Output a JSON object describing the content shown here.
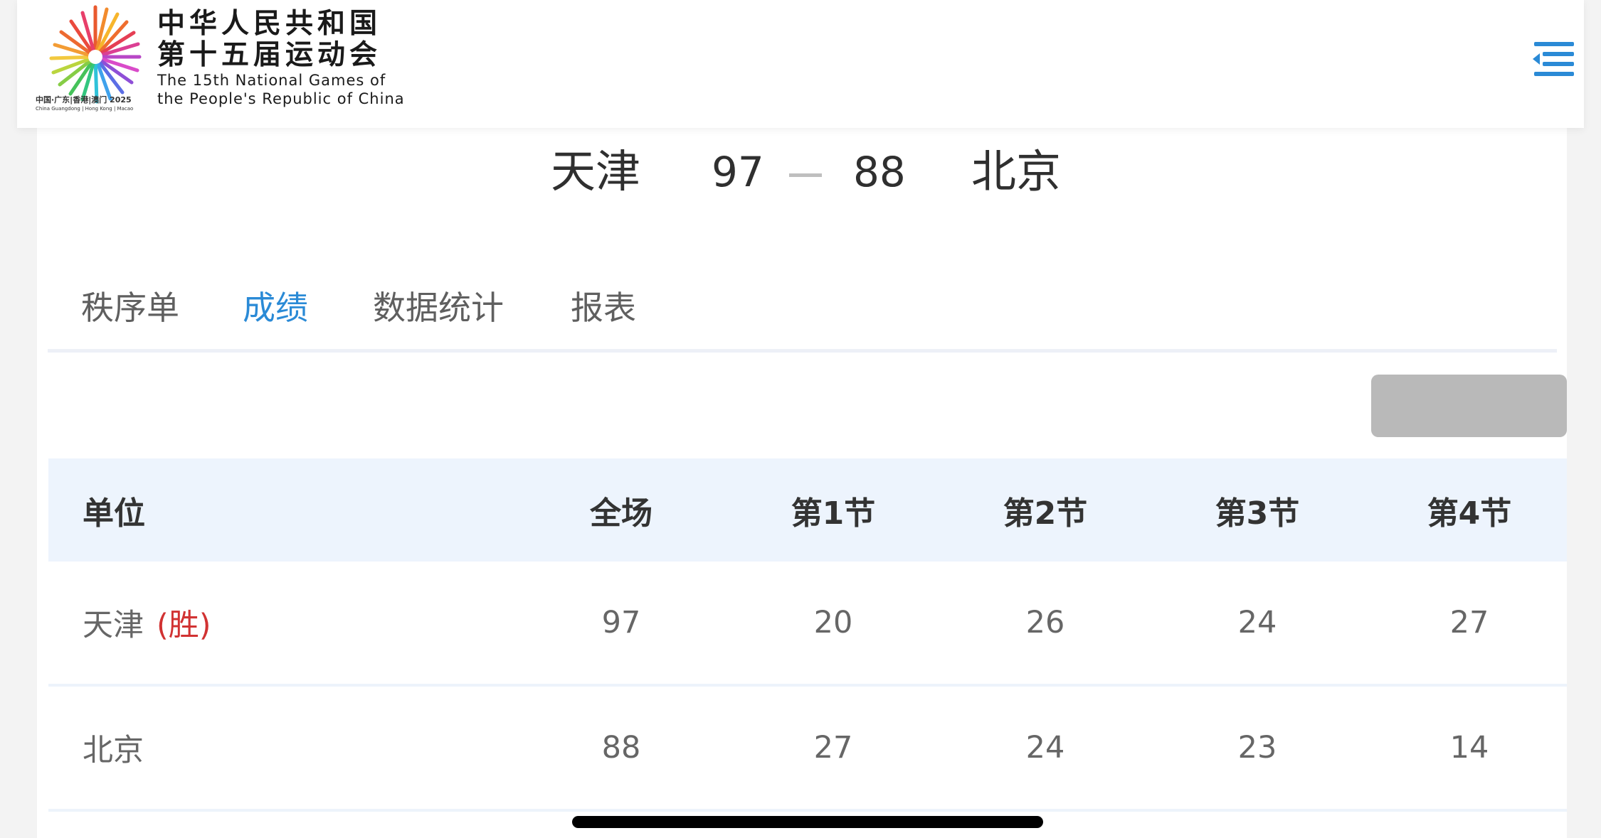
{
  "header": {
    "title_cn_line1": "中华人民共和国",
    "title_cn_line2": "第十五届运动会",
    "title_en_line1": "The 15th National Games of",
    "title_en_line2": "the People's Republic of China",
    "logo_sub_cn": "中国·广东|香港|澳门 2025",
    "logo_sub_en": "China Guangdong | Hong Kong | Macao"
  },
  "match": {
    "home_team": "天津",
    "home_score": "97",
    "away_score": "88",
    "away_team": "北京"
  },
  "tabs": [
    {
      "label": "秩序单",
      "active": false
    },
    {
      "label": "成绩",
      "active": true
    },
    {
      "label": "数据统计",
      "active": false
    },
    {
      "label": "报表",
      "active": false
    }
  ],
  "table": {
    "headers": [
      "单位",
      "全场",
      "第1节",
      "第2节",
      "第3节",
      "第4节"
    ],
    "rows": [
      {
        "team": "天津",
        "result": "(胜)",
        "total": "97",
        "q1": "20",
        "q2": "26",
        "q3": "24",
        "q4": "27"
      },
      {
        "team": "北京",
        "result": "",
        "total": "88",
        "q1": "27",
        "q2": "24",
        "q3": "23",
        "q4": "14"
      }
    ]
  },
  "colors": {
    "accent": "#2A8AD6",
    "win": "#D13232",
    "table_header_bg": "#EDF4FD",
    "action_button_bg": "#B9B9B9"
  }
}
